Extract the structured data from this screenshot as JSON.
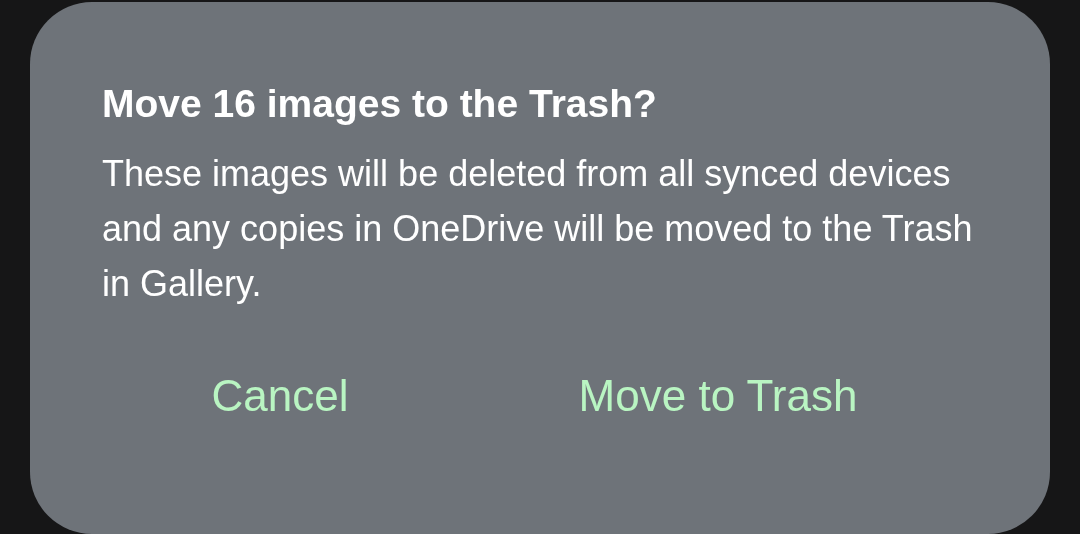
{
  "dialog": {
    "title": "Move 16 images to the Trash?",
    "message": "These images will be deleted from all synced devices and any copies in OneDrive will be moved to the Trash in Gallery.",
    "buttons": [
      {
        "label": "Cancel"
      },
      {
        "label": "Move to Trash"
      }
    ]
  }
}
